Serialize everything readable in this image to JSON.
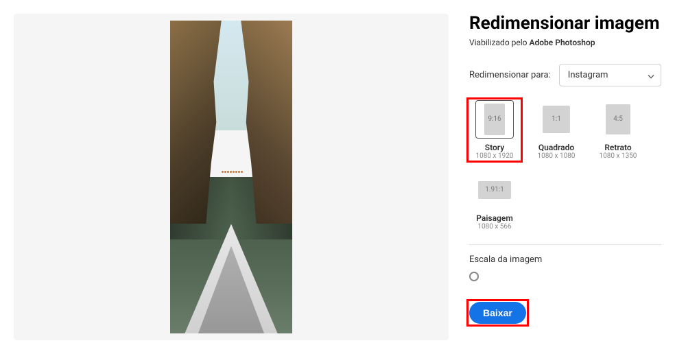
{
  "header": {
    "title": "Redimensionar imagem",
    "subtitle_prefix": "Viabilizado pelo ",
    "subtitle_brand": "Adobe Photoshop"
  },
  "resize": {
    "label": "Redimensionar para:",
    "selected_platform": "Instagram"
  },
  "presets": [
    {
      "ratio": "9:16",
      "label": "Story",
      "dims": "1080 x 1920",
      "shape": "shape-9-16",
      "selected": true,
      "highlighted": true
    },
    {
      "ratio": "1:1",
      "label": "Quadrado",
      "dims": "1080 x 1080",
      "shape": "shape-1-1",
      "selected": false,
      "highlighted": false
    },
    {
      "ratio": "4:5",
      "label": "Retrato",
      "dims": "1080 x 1350",
      "shape": "shape-4-5",
      "selected": false,
      "highlighted": false
    },
    {
      "ratio": "1.91:1",
      "label": "Paisagem",
      "dims": "1080 x 566",
      "shape": "shape-191-1",
      "selected": false,
      "highlighted": false
    }
  ],
  "scale": {
    "label": "Escala da imagem"
  },
  "actions": {
    "download_label": "Baixar"
  }
}
